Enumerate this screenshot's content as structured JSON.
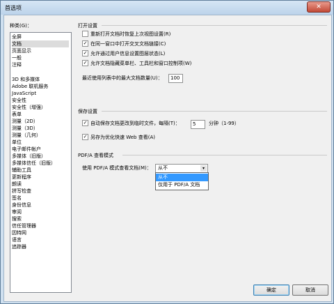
{
  "window": {
    "title": "首选项",
    "close_glyph": "✕"
  },
  "categories": {
    "label": "种类(G)：",
    "top_items": [
      "全屏",
      "文档",
      "页面显示",
      "一般",
      "注释"
    ],
    "selected": "文档",
    "items": [
      "3D 和多媒体",
      "Adobe 联机服务",
      "JavaScript",
      "安全性",
      "安全性（增强）",
      "表单",
      "测量（2D）",
      "测量（3D）",
      "测量（几何）",
      "单位",
      "电子邮件帐户",
      "多媒体（旧版）",
      "多媒体信任（旧版）",
      "辅助工具",
      "更新程序",
      "朗读",
      "拼写检查",
      "签名",
      "身份信息",
      "审阅",
      "搜索",
      "信任管理器",
      "因特网",
      "语言",
      "追踪器"
    ]
  },
  "open_settings": {
    "title": "打开设置",
    "options": [
      {
        "label": "重新打开文档时恢复上次视图设置(R)",
        "checked": false
      },
      {
        "label": "在同一窗口中打开交叉文档链接(C)",
        "checked": true
      },
      {
        "label": "允许通过用户信息设置图层状态(L)",
        "checked": true
      },
      {
        "label": "允许文档隐藏菜单栏、工具栏和窗口控制项(W)",
        "checked": true
      }
    ],
    "recent_label": "最近使用列表中的最大文档数量(U)：",
    "recent_value": "100"
  },
  "save_settings": {
    "title": "保存设置",
    "autosave_label": "自动保存文档更改到临时文件，每隔(T)：",
    "autosave_checked": true,
    "autosave_value": "5",
    "autosave_unit": "分钟（1-99）",
    "fastweb_label": "另存为优化快速 Web 查看(A)",
    "fastweb_checked": true
  },
  "pdfa": {
    "title": "PDF/A 查看模式",
    "mode_label": "使用 PDF/A 模式查看文档(M)：",
    "selected": "从不",
    "options": [
      "从不",
      "仅用于 PDF/A 文档"
    ]
  },
  "buttons": {
    "ok": "确定",
    "cancel": "取消"
  },
  "check_glyph": "✓",
  "arrow_glyph": "▾"
}
